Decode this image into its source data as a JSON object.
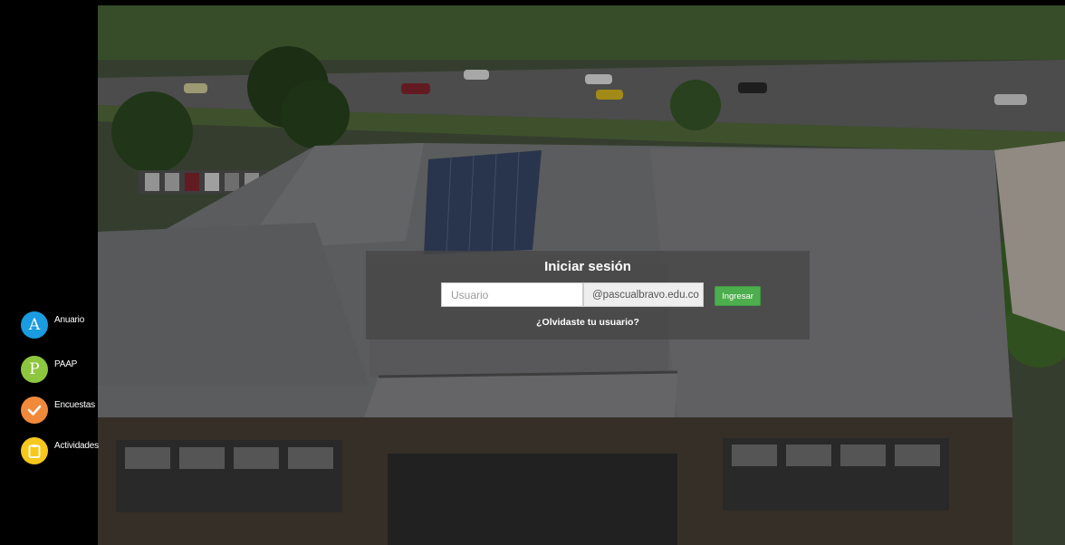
{
  "sidebar": {
    "items": [
      {
        "label": "Anuario",
        "glyph": "A",
        "color": "#1a9ce0",
        "icon": "letter-a-icon"
      },
      {
        "label": "PAAP",
        "glyph": "P",
        "color": "#8dc63f",
        "icon": "letter-p-icon"
      },
      {
        "label": "Encuestas",
        "glyph": "✔",
        "color": "#f08a3a",
        "icon": "checkmark-icon"
      },
      {
        "label": "Actividades",
        "glyph": "📋",
        "color": "#f7c71c",
        "icon": "clipboard-icon"
      }
    ]
  },
  "login": {
    "title": "Iniciar sesión",
    "username_placeholder": "Usuario",
    "username_value": "",
    "domain_suffix": "@pascualbravo.edu.co",
    "submit_label": "Ingresar",
    "forgot_link": "¿Olvidaste tu usuario?"
  },
  "colors": {
    "overlay": "#464646",
    "submit": "#4cae4c"
  }
}
